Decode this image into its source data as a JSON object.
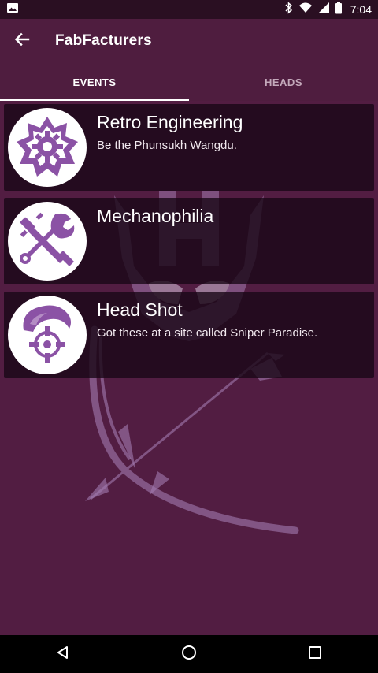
{
  "status_bar": {
    "time": "7:04",
    "icons": [
      "image-icon",
      "bluetooth-icon",
      "wifi-icon",
      "signal-icon",
      "battery-icon"
    ]
  },
  "app_bar": {
    "title": "FabFacturers",
    "back_icon": "arrow-back-icon"
  },
  "tabs": [
    {
      "label": "EVENTS",
      "active": true
    },
    {
      "label": "HEADS",
      "active": false
    }
  ],
  "events": [
    {
      "title": "Retro Engineering",
      "description": "Be the Phunsukh Wangdu.",
      "icon": "gear-badge-icon"
    },
    {
      "title": "Mechanophilia",
      "description": "",
      "icon": "wrench-tools-icon"
    },
    {
      "title": "Head Shot",
      "description": "Got these at a site called Sniper Paradise.",
      "icon": "crosshair-head-icon"
    }
  ],
  "nav_bar": {
    "icons": [
      "back-triangle-icon",
      "home-circle-icon",
      "recents-square-icon"
    ]
  },
  "colors": {
    "background": "#521d42",
    "app_bar": "#4f1d3f",
    "status_bar": "#2a0f22",
    "card": "#1a0817",
    "accent_purple": "#8b52a5",
    "watermark": "#a27bb0"
  }
}
